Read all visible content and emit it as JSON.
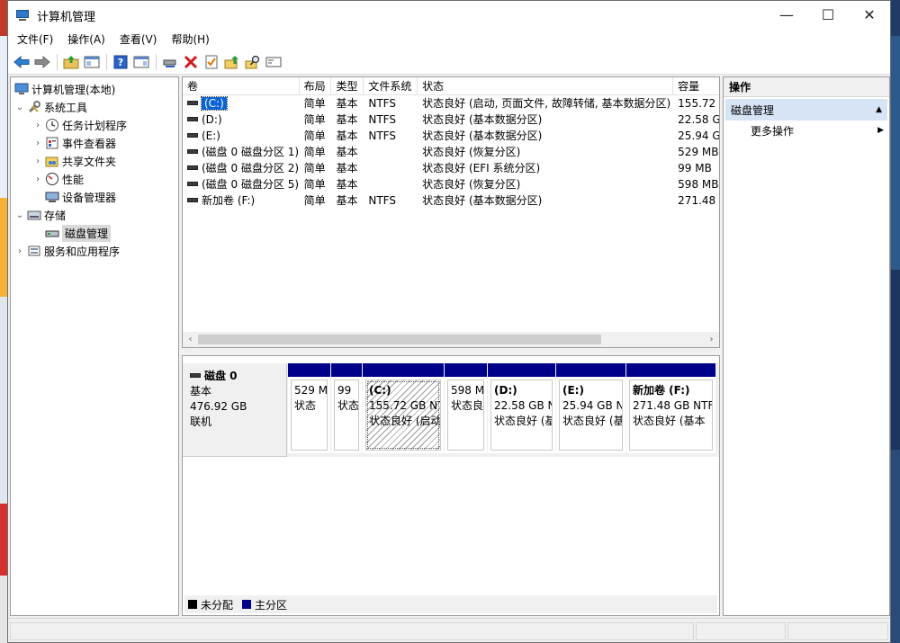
{
  "window": {
    "title": "计算机管理"
  },
  "window_buttons": {
    "minimize": "—",
    "maximize": "☐",
    "close": "✕"
  },
  "menu": [
    "文件(F)",
    "操作(A)",
    "查看(V)",
    "帮助(H)"
  ],
  "tree": {
    "root": "计算机管理(本地)",
    "system_tools": "系统工具",
    "task_scheduler": "任务计划程序",
    "event_viewer": "事件查看器",
    "shared_folders": "共享文件夹",
    "performance": "性能",
    "device_manager": "设备管理器",
    "storage": "存储",
    "disk_management": "磁盘管理",
    "services_apps": "服务和应用程序"
  },
  "volume_table": {
    "headers": [
      "卷",
      "布局",
      "类型",
      "文件系统",
      "状态",
      "容量"
    ],
    "rows": [
      {
        "name": "(C:)",
        "layout": "简单",
        "type": "基本",
        "fs": "NTFS",
        "status": "状态良好 (启动, 页面文件, 故障转储, 基本数据分区)",
        "capacity": "155.72"
      },
      {
        "name": "(D:)",
        "layout": "简单",
        "type": "基本",
        "fs": "NTFS",
        "status": "状态良好 (基本数据分区)",
        "capacity": "22.58 G"
      },
      {
        "name": "(E:)",
        "layout": "简单",
        "type": "基本",
        "fs": "NTFS",
        "status": "状态良好 (基本数据分区)",
        "capacity": "25.94 G"
      },
      {
        "name": "(磁盘 0 磁盘分区 1)",
        "layout": "简单",
        "type": "基本",
        "fs": "",
        "status": "状态良好 (恢复分区)",
        "capacity": "529 MB"
      },
      {
        "name": "(磁盘 0 磁盘分区 2)",
        "layout": "简单",
        "type": "基本",
        "fs": "",
        "status": "状态良好 (EFI 系统分区)",
        "capacity": "99 MB"
      },
      {
        "name": "(磁盘 0 磁盘分区 5)",
        "layout": "简单",
        "type": "基本",
        "fs": "",
        "status": "状态良好 (恢复分区)",
        "capacity": "598 MB"
      },
      {
        "name": "新加卷 (F:)",
        "layout": "简单",
        "type": "基本",
        "fs": "NTFS",
        "status": "状态良好 (基本数据分区)",
        "capacity": "271.48"
      }
    ]
  },
  "disk": {
    "name": "磁盘 0",
    "type": "基本",
    "size": "476.92 GB",
    "state": "联机",
    "partitions": [
      {
        "name": "",
        "size": "529 M",
        "status": "状态"
      },
      {
        "name": "",
        "size": "99",
        "status": "状态"
      },
      {
        "name": "(C:)",
        "size": "155.72 GB NT",
        "status": "状态良好 (启动"
      },
      {
        "name": "",
        "size": "598 M",
        "status": "状态良"
      },
      {
        "name": "(D:)",
        "size": "22.58 GB N",
        "status": "状态良好 (基"
      },
      {
        "name": "(E:)",
        "size": "25.94 GB N",
        "status": "状态良好 (基"
      },
      {
        "name": "新加卷  (F:)",
        "size": "271.48 GB NTF",
        "status": "状态良好 (基本"
      }
    ]
  },
  "legend": {
    "unallocated": "未分配",
    "primary": "主分区"
  },
  "colors": {
    "primary_partition": "#00008b",
    "unallocated": "#000000",
    "selection": "#0a64d6"
  },
  "actions": {
    "header": "操作",
    "section": "磁盘管理",
    "more": "更多操作"
  }
}
